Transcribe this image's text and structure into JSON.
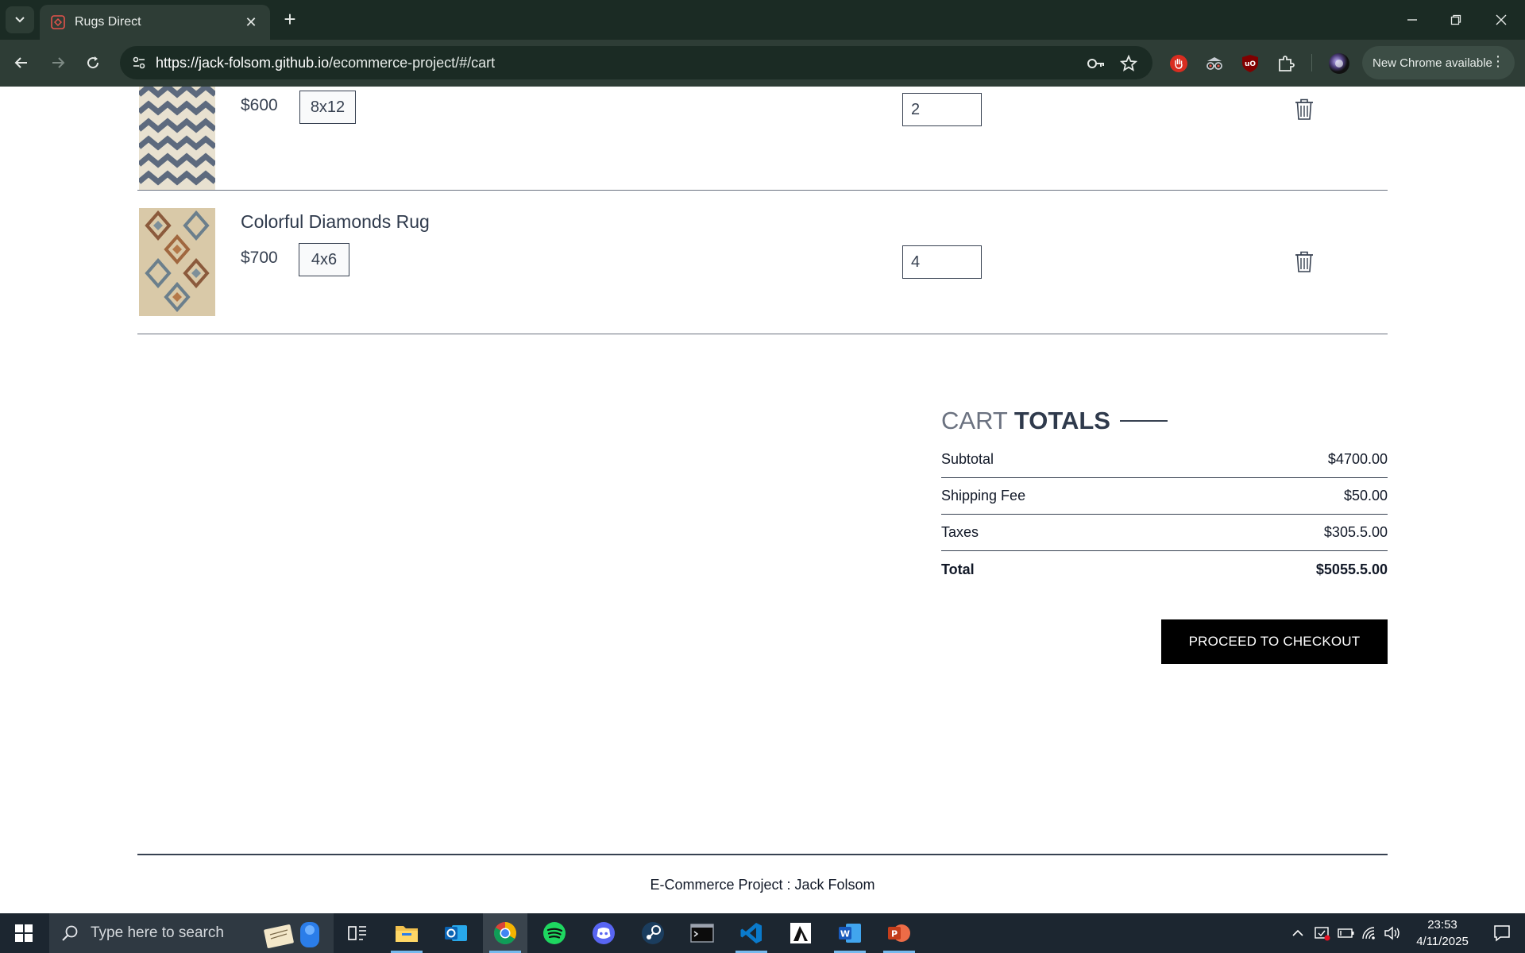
{
  "browser": {
    "tab_title": "Rugs Direct",
    "tab_close": "✕",
    "new_tab": "+",
    "url_host": "https://jack-folsom.github.io",
    "url_path": "/ecommerce-project/#/cart",
    "update_label": "New Chrome available",
    "menu_dots": "⋮"
  },
  "cart": {
    "items": [
      {
        "name": "",
        "price": "$600",
        "size": "8x12",
        "quantity": "2"
      },
      {
        "name": "Colorful Diamonds Rug",
        "price": "$700",
        "size": "4x6",
        "quantity": "4"
      }
    ]
  },
  "totals": {
    "title_part1": "CART",
    "title_part2": "TOTALS",
    "subtotal_label": "Subtotal",
    "subtotal_value": "$4700.00",
    "shipping_label": "Shipping Fee",
    "shipping_value": "$50.00",
    "taxes_label": "Taxes",
    "taxes_value": "$305.5.00",
    "total_label": "Total",
    "total_value": "$5055.5.00",
    "checkout_label": "PROCEED TO CHECKOUT"
  },
  "footer": {
    "text": "E-Commerce Project : Jack Folsom"
  },
  "taskbar": {
    "search_placeholder": "Type here to search",
    "time": "23:53",
    "date": "4/11/2025"
  },
  "colors": {
    "accent_black": "#000000",
    "chrome_dark": "#1b2b24",
    "chrome_toolbar": "#2e3d36",
    "text_dark": "#2f3a4c"
  }
}
